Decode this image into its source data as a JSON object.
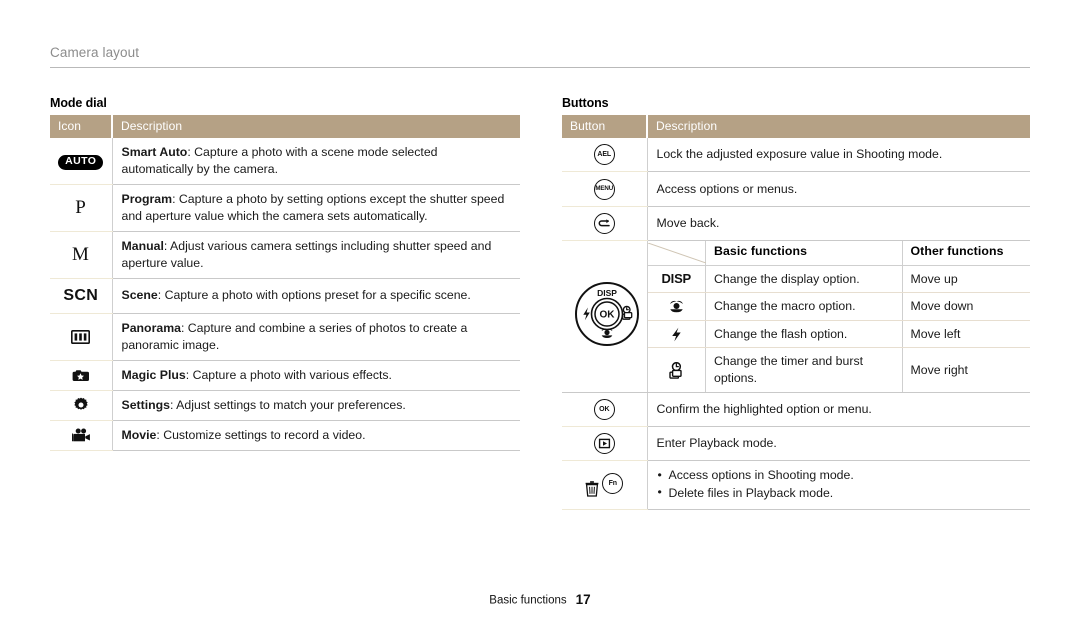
{
  "header": {
    "running_title": "Camera layout"
  },
  "mode_dial": {
    "section_title": "Mode dial",
    "columns": [
      "Icon",
      "Description"
    ],
    "rows": [
      {
        "icon": "auto-badge-icon",
        "icon_text": "AUTO",
        "term": "Smart Auto",
        "desc": ": Capture a photo with a scene mode selected automatically by the camera."
      },
      {
        "icon": "program-p-icon",
        "icon_text": "P",
        "term": "Program",
        "desc": ": Capture a photo by setting options except the shutter speed and aperture value which the camera sets automatically."
      },
      {
        "icon": "manual-m-icon",
        "icon_text": "M",
        "term": "Manual",
        "desc": ": Adjust various camera settings including shutter speed and aperture value."
      },
      {
        "icon": "scene-scn-icon",
        "icon_text": "SCN",
        "term": "Scene",
        "desc": ": Capture a photo with options preset for a specific scene."
      },
      {
        "icon": "panorama-icon",
        "icon_text": "",
        "term": "Panorama",
        "desc": ": Capture and combine a series of photos to create a panoramic image."
      },
      {
        "icon": "magic-plus-icon",
        "icon_text": "",
        "term": "Magic Plus",
        "desc": ": Capture a photo with various effects."
      },
      {
        "icon": "settings-gear-icon",
        "icon_text": "",
        "term": "Settings",
        "desc": ": Adjust settings to match your preferences."
      },
      {
        "icon": "movie-camera-icon",
        "icon_text": "",
        "term": "Movie",
        "desc": ": Customize settings to record a video."
      }
    ]
  },
  "buttons": {
    "section_title": "Buttons",
    "columns": [
      "Button",
      "Description"
    ],
    "rows": [
      {
        "icon": "ael-button-icon",
        "icon_text": "AEL",
        "desc": "Lock the adjusted exposure value in Shooting mode."
      },
      {
        "icon": "menu-button-icon",
        "icon_text": "MENU",
        "desc": "Access options or menus."
      },
      {
        "icon": "back-button-icon",
        "icon_text": "",
        "desc": "Move back."
      }
    ],
    "nav_pad": {
      "icon": "navigation-pad-icon",
      "labels": {
        "up": "DISP",
        "center": "OK",
        "left": "flash-icon",
        "right": "timer-burst-icon",
        "down": "macro-icon"
      },
      "sub_table": {
        "columns": [
          "",
          "Basic functions",
          "Other functions"
        ],
        "rows": [
          {
            "key": "DISP",
            "key_icon": "disp-icon",
            "basic": "Change the display option.",
            "other": "Move up"
          },
          {
            "key": "",
            "key_icon": "macro-icon",
            "basic": "Change the macro option.",
            "other": "Move down"
          },
          {
            "key": "",
            "key_icon": "flash-icon",
            "basic": "Change the flash option.",
            "other": "Move left"
          },
          {
            "key": "",
            "key_icon": "timer-burst-icon",
            "basic": "Change the timer and burst options.",
            "other": "Move right"
          }
        ]
      }
    },
    "rows_after": [
      {
        "icon": "ok-button-icon",
        "icon_text": "OK",
        "desc": "Confirm the highlighted option or menu."
      },
      {
        "icon": "playback-button-icon",
        "icon_text": "",
        "desc": "Enter Playback mode."
      },
      {
        "icon": "delete-fn-button-icon",
        "icon_text": "Fn",
        "bullets": [
          "Access options in Shooting mode.",
          "Delete files in Playback mode."
        ]
      }
    ]
  },
  "footer": {
    "chapter": "Basic functions",
    "page_number": "17"
  },
  "colors": {
    "table_header_bg": "#b5a185",
    "table_header_text": "#ffffff",
    "running_header_text": "#8c8c8c",
    "rule": "#b9b9b9",
    "row_divider": "#c9c9c9",
    "icon_divider": "#efe9d6"
  }
}
